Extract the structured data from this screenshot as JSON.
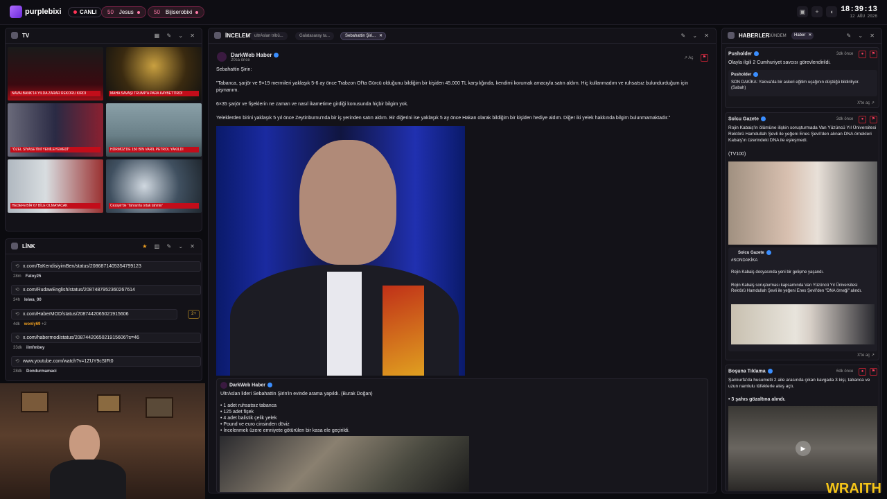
{
  "header": {
    "brand": "purplebixi",
    "live_label": "CANLI",
    "pills": [
      {
        "count": "50",
        "label": "Jesus"
      },
      {
        "count": "50",
        "label": "Bijiserobixi"
      }
    ],
    "clock_time": "18:39:13",
    "clock_date": "12 AĞU 2026"
  },
  "tv": {
    "title": "TV",
    "tiles": [
      {
        "caption": "NAVALBANK'14 YILDA ZARAR REKORU KIRDI"
      },
      {
        "caption": "MAHA SAVAŞI TRUMP'A PARA KAYBETTİRDİ"
      },
      {
        "caption": "\"ÖZEL SİYASETİNİ YENİLEYEMEDİ\""
      },
      {
        "caption": "HÜRMÜZ'DE 150 BİN VARİL PETROL YAKILDI"
      },
      {
        "caption": "HEDEFE'BİR 67 BİLE OLMAYACAK"
      },
      {
        "caption": "Cezayir'de 'Tahran'la ortak tahmin'"
      }
    ]
  },
  "links": {
    "title": "LİNK",
    "items": [
      {
        "url": "x.com/TaKendisiyimBen/status/2086871405354799123",
        "age": "28m",
        "user": "Fatoy25"
      },
      {
        "url": "x.com/RudawEnglish/status/2087487952360267614",
        "age": "34h",
        "user": "leiwa_00"
      },
      {
        "url": "x.com/HaberMOD/status/2087442065021915606",
        "age": "4dk",
        "user": "wonly69",
        "extra": "+2",
        "badge": "2+"
      },
      {
        "url": "x.com/habermod/status/2087442065021915606?s=46",
        "age": "33dk",
        "user": "ilmfmbey"
      },
      {
        "url": "www.youtube.com/watch?v=1ZUY9cSIFt0",
        "age": "28dk",
        "user": "Dondurmamaci"
      }
    ]
  },
  "review": {
    "title": "İNCELEME",
    "tabs": [
      "ultrAslan tribü...",
      "Galatasaray ta...",
      "Sebahattin Şiri..."
    ],
    "post": {
      "author": "DarkWeb Haber",
      "time": "20sa önce",
      "open_label": "Aç",
      "lead": "Sebahattin Şirin:",
      "p1": "\"Tabanca, şarjör ve 9×19 mermileri yaklaşık 5-6 ay önce Trabzon Of'ta Gürcü olduğunu bildiğim bir kişiden 45.000 TL karşılığında, kendimi korumak amacıyla satın aldım. Hiç kullanmadım ve ruhsatsız bulundurduğum için pişmanım.",
      "p2": "6×35 şarjör ve fişeklerin ne zaman ve nasıl ikametime girdiği konusunda hiçbir bilgim yok.",
      "p3": "Yeleklerden birini yaklaşık 5 yıl önce Zeytinburnu'nda bir iş yerinden satın aldım. Bir diğerini ise yaklaşık 5 ay önce Hakan olarak bildiğim bir kişiden hediye aldım. Diğer iki yelek hakkında bilgim bulunmamaktadır.\""
    },
    "quote": {
      "author": "DarkWeb Haber",
      "text": "UltrAslan lideri Sebahattin Şirin'in evinde arama yapıldı. (Burak Doğan)",
      "bullets": [
        "1 adet ruhsatsız tabanca",
        "125 adet fişek",
        "4 adet balistik çelik yelek",
        "Pound ve euro cinsinden döviz",
        "İncelenmek üzere emniyete götürülen bir kasa ele geçirildi."
      ]
    }
  },
  "news": {
    "title": "HABERLER",
    "tabs": [
      "GÜNDEM",
      "Haber"
    ],
    "items": [
      {
        "author": "Pusholder",
        "age": "3dk önce",
        "text": "Olayla ilgili 2 Cumhuriyet savcısı görevlendirildi.",
        "quote_author": "Pusholder",
        "quote_text": "SON DAKİKA: Yalova'da bir askeri eğitim uçağının düştüğü bildiriliyor. (Sabah)",
        "open": "X'te aç"
      },
      {
        "author": "Solcu Gazete",
        "age": "3dk önce",
        "text": "Rojin Kabaiş'in ölümüne ilişkin soruşturmada Van Yüzüncü Yıl Üniversitesi Rektörü Hamdullah Şevli ile yeğeni Enes Şevli'den alınan DNA örnekleri Kabaiş'ın üzerindeki DNA ile eşleşmedi.",
        "source": "(TV100)",
        "quote_author": "Solcu Gazete",
        "quote_tag": "#SONDAKİKA",
        "quote_line1": "Rojin Kabaiş dosyasında yeni bir gelişme yaşandı.",
        "quote_line2": "Rojin Kabaiş soruşturması kapsamında Van Yüzüncü Yıl Üniversitesi Rektörü Hamdullah Şevli ile yeğeni Enes Şevli'den \"DNA örneği\" alındı.",
        "open": "X'te aç"
      },
      {
        "author": "Boşuna Tıklama",
        "age": "6dk önce",
        "text": "Şanlıurfa'da husumetli 2 aile arasında çıkan kavgada 3 kişi, tabanca ve uzun namlulu tüfeklerle ateş açtı.",
        "bullet": "• 3 şahıs gözaltına alındı."
      }
    ]
  },
  "watermark": "WRAITH",
  "colors": {
    "accent": "#b06cff",
    "live": "#ff3355",
    "verified": "#3a8eff"
  }
}
